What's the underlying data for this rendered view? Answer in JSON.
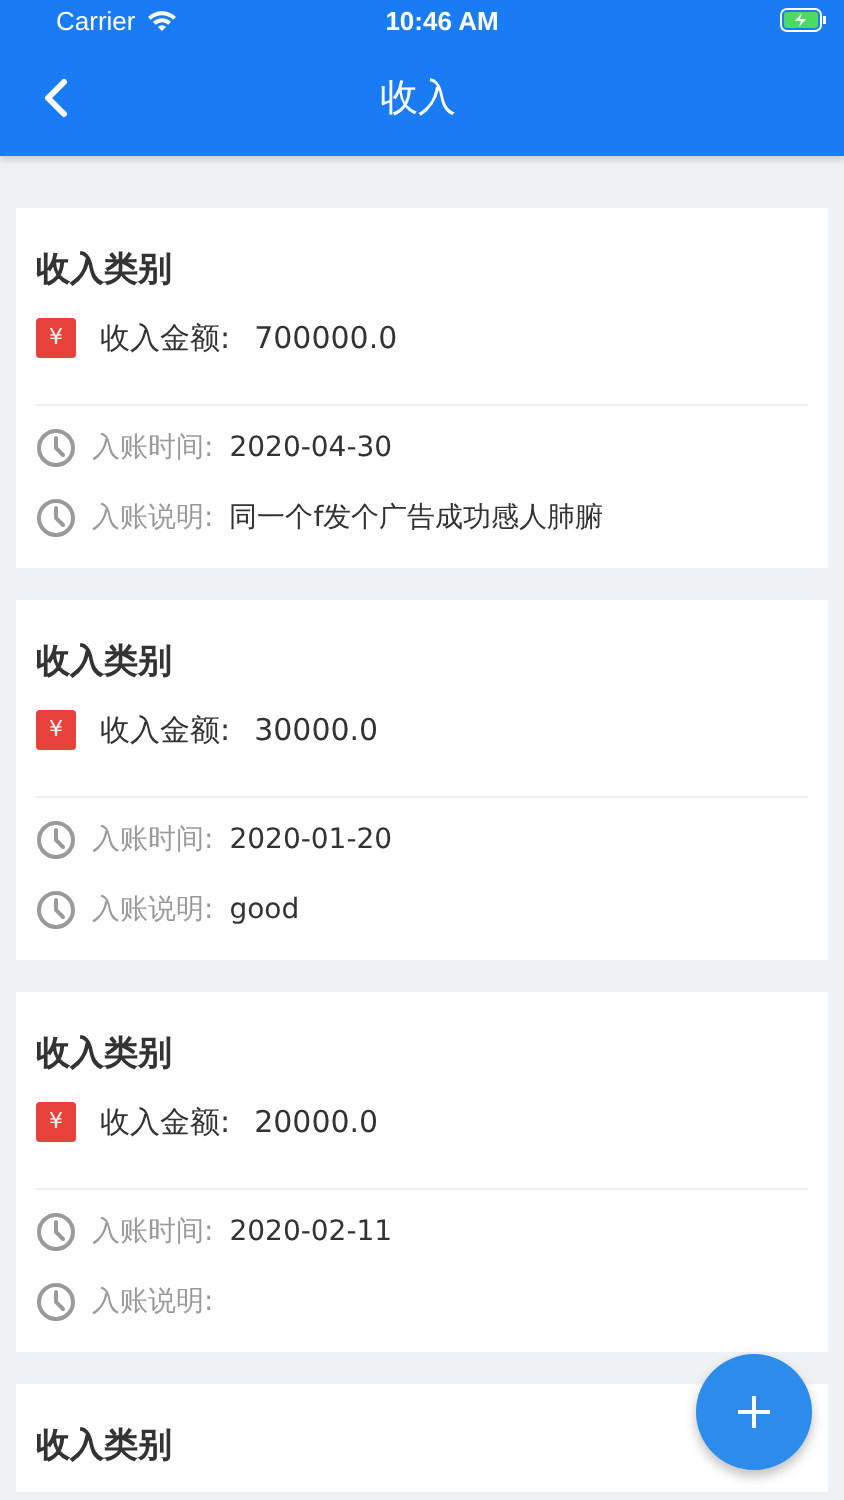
{
  "status_bar": {
    "carrier": "Carrier",
    "time": "10:46 AM"
  },
  "nav": {
    "title": "收入"
  },
  "records": [
    {
      "category": "收入类别",
      "amount_label": "收入金额:",
      "amount": "700000.0",
      "currency_symbol": "¥",
      "time_label": "入账时间:",
      "time": "2020-04-30",
      "note_label": "入账说明:",
      "note": "同一个f发个广告成功感人肺腑"
    },
    {
      "category": "收入类别",
      "amount_label": "收入金额:",
      "amount": "30000.0",
      "currency_symbol": "¥",
      "time_label": "入账时间:",
      "time": "2020-01-20",
      "note_label": "入账说明:",
      "note": "good"
    },
    {
      "category": "收入类别",
      "amount_label": "收入金额:",
      "amount": "20000.0",
      "currency_symbol": "¥",
      "time_label": "入账时间:",
      "time": "2020-02-11",
      "note_label": "入账说明:"
    },
    {
      "category": "收入类别"
    }
  ]
}
